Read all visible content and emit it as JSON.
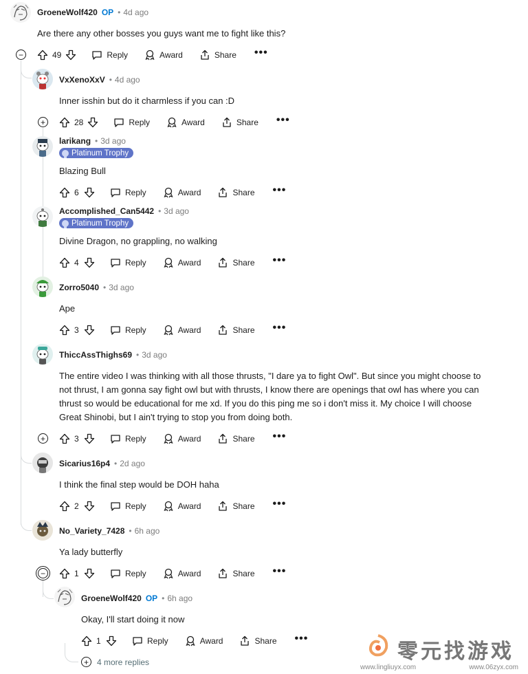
{
  "comments": [
    {
      "user": "GroeneWolf420",
      "op": "OP",
      "time": "4d ago",
      "flair": "",
      "text": "Are there any other bosses you guys want me to fight like this?",
      "score": "49",
      "expander": "−"
    },
    {
      "user": "VxXenoXxV",
      "op": "",
      "time": "4d ago",
      "flair": "",
      "text": "Inner isshin but do it charmless if you can :D",
      "score": "28",
      "expander": "+"
    },
    {
      "user": "larikang",
      "op": "",
      "time": "3d ago",
      "flair": "Platinum Trophy",
      "text": "Blazing Bull",
      "score": "6",
      "expander": ""
    },
    {
      "user": "Accomplished_Can5442",
      "op": "",
      "time": "3d ago",
      "flair": "Platinum Trophy",
      "text": "Divine Dragon, no grappling, no walking",
      "score": "4",
      "expander": ""
    },
    {
      "user": "Zorro5040",
      "op": "",
      "time": "3d ago",
      "flair": "",
      "text": "Ape",
      "score": "3",
      "expander": ""
    },
    {
      "user": "ThiccAssThighs69",
      "op": "",
      "time": "3d ago",
      "flair": "",
      "text_lines": [
        "The entire video I was thinking with all those thrusts, \"I dare ya to fight Owl\". But since you might choose to",
        "not thrust, I am gonna say fight owl but with thrusts, I know there are openings that owl has where you can",
        "thrust so would be educational for me xd. If you do this ping me so i don't miss it. My choice I will choose",
        "Great Shinobi, but I ain't trying to stop you from doing both."
      ],
      "score": "3",
      "expander": "+"
    },
    {
      "user": "Sicarius16p4",
      "op": "",
      "time": "2d ago",
      "flair": "",
      "text": "I think the final step would be DOH haha",
      "score": "2",
      "expander": ""
    },
    {
      "user": "No_Variety_7428",
      "op": "",
      "time": "6h ago",
      "flair": "",
      "text": "Ya lady butterfly",
      "score": "1",
      "expander": "−"
    },
    {
      "user": "GroeneWolf420",
      "op": "OP",
      "time": "6h ago",
      "flair": "",
      "text": "Okay, I'll start doing it now",
      "score": "1",
      "expander": ""
    }
  ],
  "labels": {
    "reply": "Reply",
    "award": "Award",
    "share": "Share",
    "more": "•••",
    "dot": "•"
  },
  "more_replies": "4 more replies",
  "watermark": {
    "brand": "零元找游戏",
    "url1": "www.lingliuyx.com",
    "url2": "www.06zyx.com"
  },
  "colors": {
    "op": "#0079d3",
    "flair": "#5f74c8",
    "thread": "#d9dcde",
    "muted": "#7c7c7c"
  },
  "icons": {
    "upvote": "arrow-up-icon",
    "downvote": "arrow-down-icon",
    "reply": "speech-bubble-icon",
    "award": "award-ribbon-icon",
    "share": "share-icon",
    "more": "ellipsis-icon",
    "collapse": "minus-circle-icon",
    "expand": "plus-circle-icon"
  }
}
